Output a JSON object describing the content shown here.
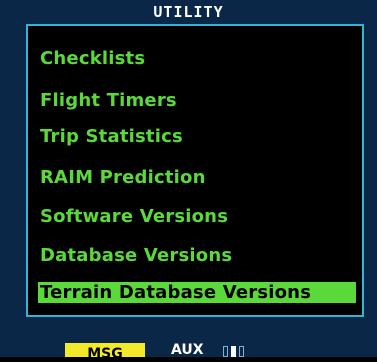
{
  "header": {
    "title": "UTILITY"
  },
  "menu": {
    "items": [
      {
        "label": "Checklists",
        "selected": false
      },
      {
        "label": "Flight Timers",
        "selected": false
      },
      {
        "label": "Trip Statistics",
        "selected": false
      },
      {
        "label": "RAIM Prediction",
        "selected": false
      },
      {
        "label": "Software Versions",
        "selected": false
      },
      {
        "label": "Database Versions",
        "selected": false
      },
      {
        "label": "Terrain Database Versions",
        "selected": true
      }
    ]
  },
  "status_bar": {
    "msg_label": "MSG",
    "page_group_label": "AUX",
    "page_count": 3,
    "active_page": 2
  },
  "colors": {
    "background": "#0b2747",
    "menu_text": "#5bd83a",
    "highlight": "#5bd83a",
    "border": "#2fb6d6",
    "msg_background": "#f2ea2a",
    "title_text": "#ffffff"
  }
}
